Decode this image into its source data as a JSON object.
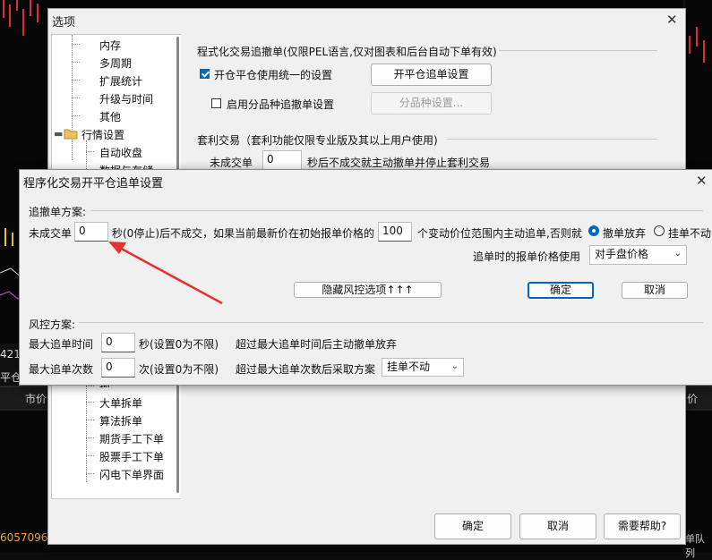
{
  "background": {
    "left_value": "421.",
    "left_tab": "平仓",
    "market_price": "市价",
    "right_price": "价",
    "bottom_number": "6057096",
    "bottom_right": "单队列"
  },
  "options": {
    "title": "选项",
    "tree": {
      "items_top": [
        "内存",
        "多周期",
        "扩展统计",
        "升级与时间",
        "其他"
      ],
      "folder": "行情设置",
      "items_mid": [
        "自动收盘",
        "数据与存储"
      ],
      "items_bottom": [
        "报",
        "大单拆单",
        "算法拆单",
        "期货手工下单",
        "股票手工下单",
        "闪电下单界面"
      ]
    },
    "prog": {
      "section_title": "程式化交易追撤单(仅限PEL语言,仅对图表和后台自动下单有效)",
      "unify_label": "开仓平仓使用统一的设置",
      "open_close_btn": "开平仓追单设置",
      "per_variety_label": "启用分品种追撤单设置",
      "per_variety_btn": "分品种设置...",
      "arb_title": "套利交易（套利功能仅限专业版及其以上用户使用)",
      "arb_unfilled": "未成交单",
      "arb_value": "0",
      "arb_suffix": "秒后不成交就主动撤单并停止套利交易"
    },
    "ok": "确定",
    "cancel": "取消",
    "help": "需要帮助?"
  },
  "dialog": {
    "title": "程序化交易开平仓追单设置",
    "section1": "追撤单方案:",
    "unfilled_label": "未成交单",
    "unfilled_value": "0",
    "sentence_a": "秒(0停止)后不成交，如果当前最新价在初始报单价格的",
    "ticks_value": "100",
    "sentence_b": "个变动价位范围内主动追单,否则就",
    "radio1": "撤单放弃",
    "radio2": "挂单不动",
    "price_label": "追单时的报单价格使用",
    "price_value": "对手盘价格",
    "hide_risk_btn": "隐藏风控选项↑↑↑",
    "ok": "确定",
    "cancel": "取消",
    "section2": "风控方案:",
    "max_time_label": "最大追单时间",
    "max_time_value": "0",
    "max_time_unit": "秒(设置0为不限)",
    "max_time_desc": "超过最大追单时间后主动撤单放弃",
    "max_count_label": "最大追单次数",
    "max_count_value": "0",
    "max_count_unit": "次(设置0为不限)",
    "max_count_desc": "超过最大追单次数后采取方案",
    "after_value": "挂单不动"
  },
  "colors": {
    "accent": "#0067c0",
    "arrow": "#e8312f"
  }
}
